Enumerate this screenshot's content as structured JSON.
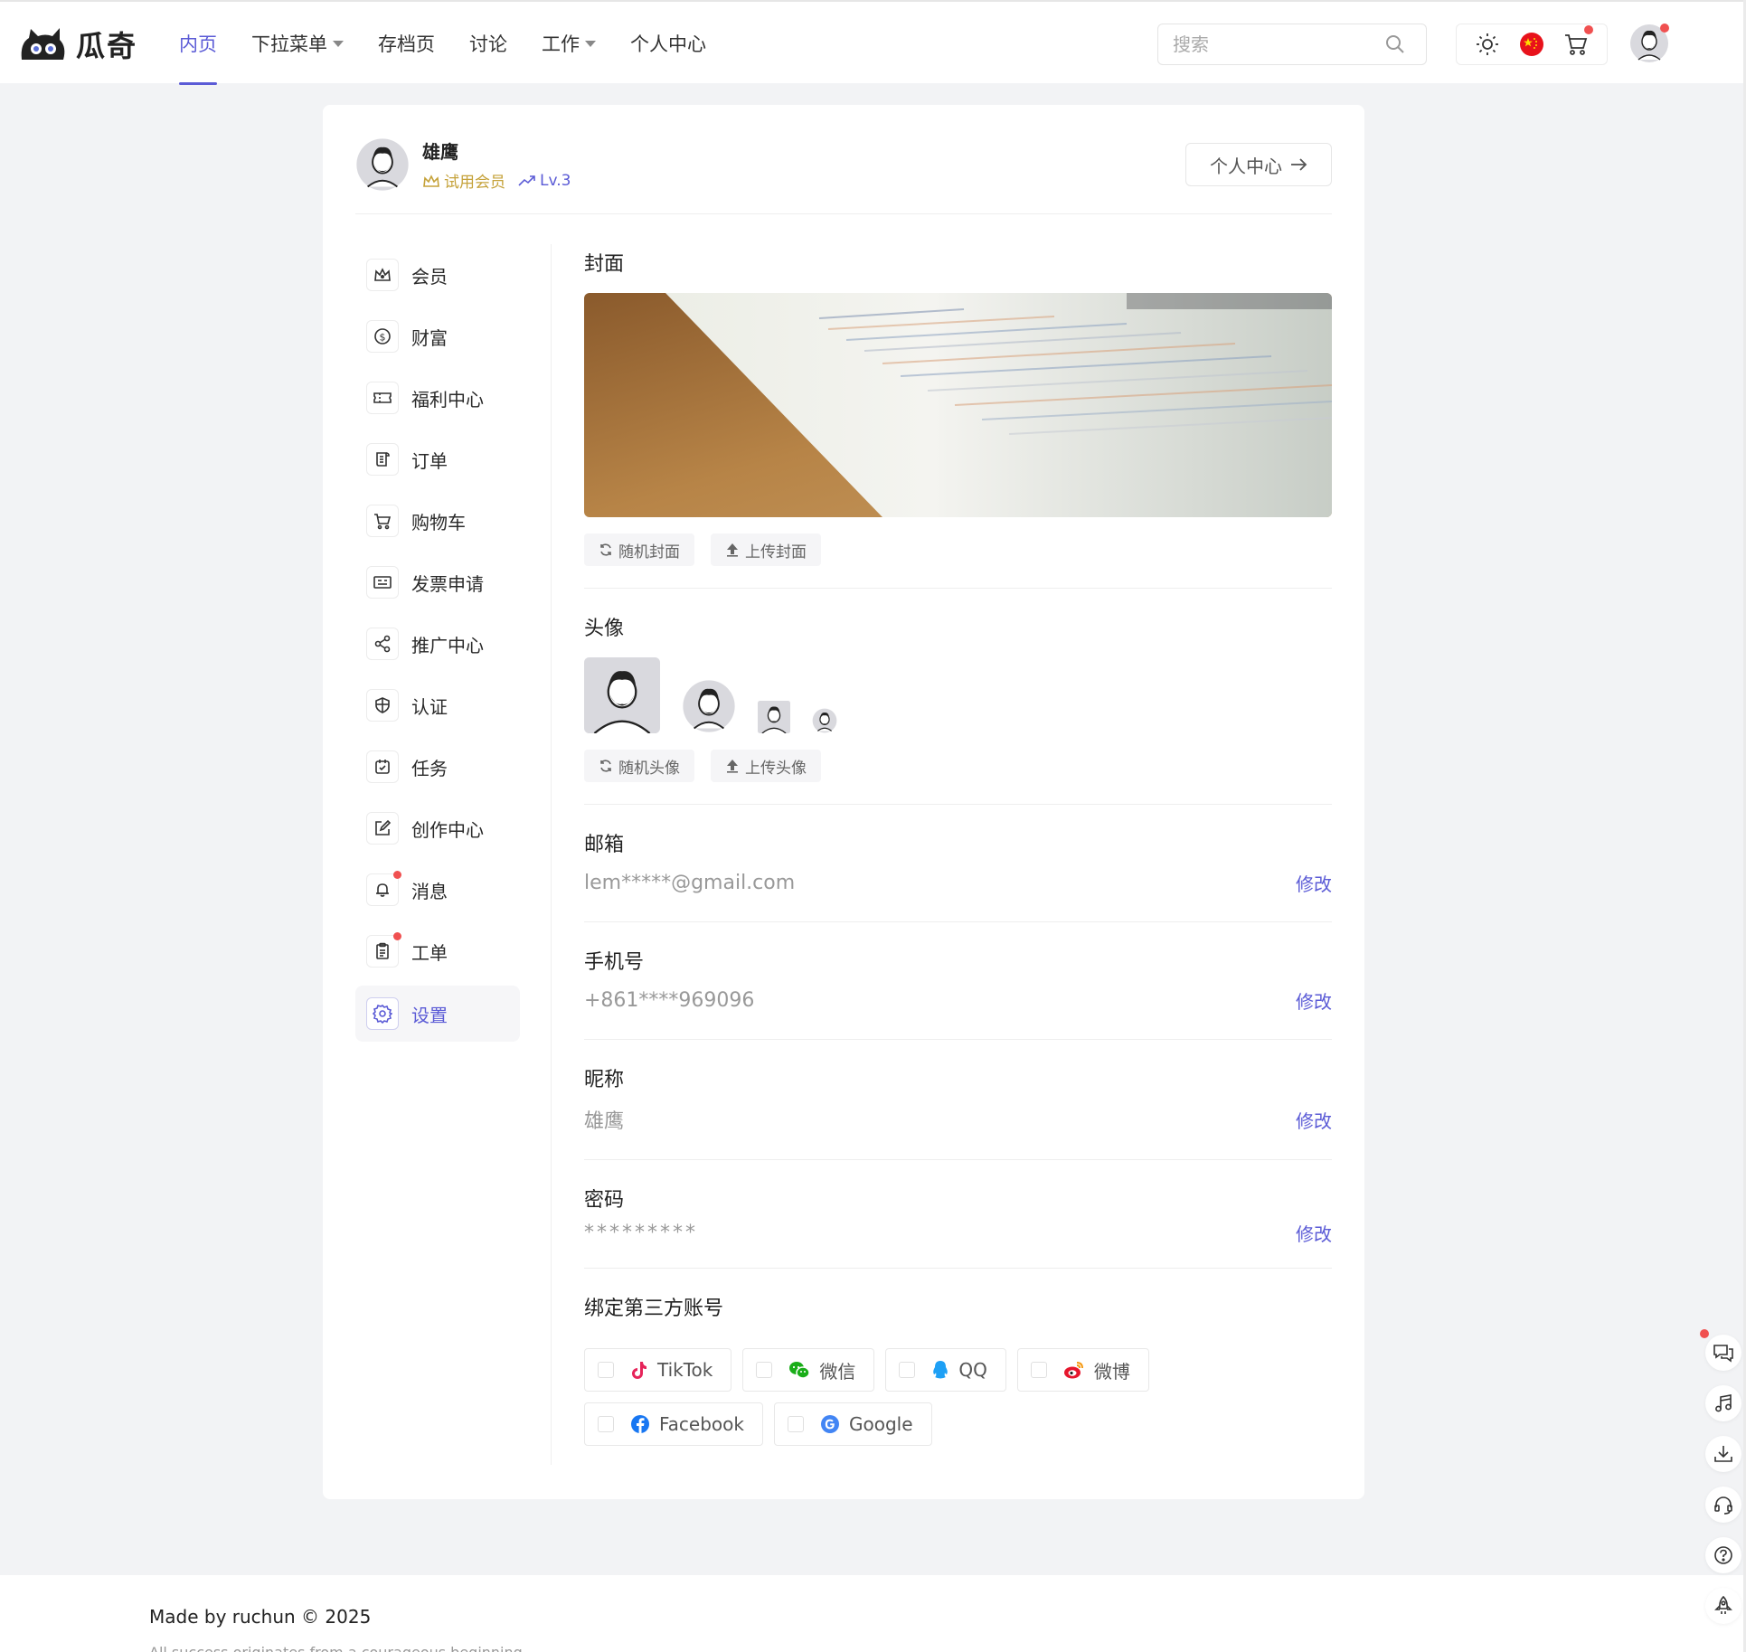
{
  "app": {
    "logo_text": "瓜奇"
  },
  "nav": {
    "items": [
      {
        "label": "内页",
        "active": true,
        "has_caret": false
      },
      {
        "label": "下拉菜单",
        "active": false,
        "has_caret": true
      },
      {
        "label": "存档页",
        "active": false,
        "has_caret": false
      },
      {
        "label": "讨论",
        "active": false,
        "has_caret": false
      },
      {
        "label": "工作",
        "active": false,
        "has_caret": true
      },
      {
        "label": "个人中心",
        "active": false,
        "has_caret": false
      }
    ]
  },
  "search": {
    "placeholder": "搜索",
    "value": ""
  },
  "toolbar": {
    "icons": [
      "sun-icon",
      "china-flag-icon",
      "cart-icon"
    ]
  },
  "user": {
    "name": "雄鹰",
    "membership": "试用会员",
    "level": "Lv.3",
    "center_button": "个人中心"
  },
  "sidebar": {
    "items": [
      {
        "label": "会员",
        "icon": "crown-icon",
        "badge": false,
        "active": false
      },
      {
        "label": "财富",
        "icon": "coin-icon",
        "badge": false,
        "active": false
      },
      {
        "label": "福利中心",
        "icon": "ticket-icon",
        "badge": false,
        "active": false
      },
      {
        "label": "订单",
        "icon": "scroll-icon",
        "badge": false,
        "active": false
      },
      {
        "label": "购物车",
        "icon": "cart-icon",
        "badge": false,
        "active": false
      },
      {
        "label": "发票申请",
        "icon": "invoice-icon",
        "badge": false,
        "active": false
      },
      {
        "label": "推广中心",
        "icon": "share-icon",
        "badge": false,
        "active": false
      },
      {
        "label": "认证",
        "icon": "shield-icon",
        "badge": false,
        "active": false
      },
      {
        "label": "任务",
        "icon": "task-icon",
        "badge": false,
        "active": false
      },
      {
        "label": "创作中心",
        "icon": "edit-icon",
        "badge": false,
        "active": false
      },
      {
        "label": "消息",
        "icon": "bell-icon",
        "badge": true,
        "active": false
      },
      {
        "label": "工单",
        "icon": "clipboard-icon",
        "badge": true,
        "active": false
      },
      {
        "label": "设置",
        "icon": "gear-icon",
        "badge": false,
        "active": true
      }
    ]
  },
  "settings": {
    "cover": {
      "title": "封面",
      "random_label": "随机封面",
      "upload_label": "上传封面"
    },
    "avatar": {
      "title": "头像",
      "random_label": "随机头像",
      "upload_label": "上传头像"
    },
    "email": {
      "title": "邮箱",
      "value": "lem*****@gmail.com",
      "edit": "修改"
    },
    "phone": {
      "title": "手机号",
      "value": "+861****969096",
      "edit": "修改"
    },
    "nickname": {
      "title": "昵称",
      "value": "雄鹰",
      "edit": "修改"
    },
    "password": {
      "title": "密码",
      "value": "*********",
      "edit": "修改"
    },
    "third_party": {
      "title": "绑定第三方账号",
      "accounts": [
        {
          "label": "TikTok",
          "icon": "tiktok-icon",
          "color": "#e6245a"
        },
        {
          "label": "微信",
          "icon": "wechat-icon",
          "color": "#1aad19"
        },
        {
          "label": "QQ",
          "icon": "qq-icon",
          "color": "#1ea0f5"
        },
        {
          "label": "微博",
          "icon": "weibo-icon",
          "color": "#e6162d"
        },
        {
          "label": "Facebook",
          "icon": "facebook-icon",
          "color": "#1877f2"
        },
        {
          "label": "Google",
          "icon": "google-icon",
          "color": "#4285f4"
        }
      ]
    }
  },
  "footer": {
    "made_by": "Made by ruchun © 2025",
    "tagline": "All success originates from a courageous beginning"
  },
  "float_tools": [
    "chat-icon",
    "music-icon",
    "download-icon",
    "headset-icon",
    "help-icon",
    "rocket-icon"
  ],
  "colors": {
    "accent": "#5b5bd6",
    "badge": "#f05050",
    "vip": "#c5a23a"
  }
}
